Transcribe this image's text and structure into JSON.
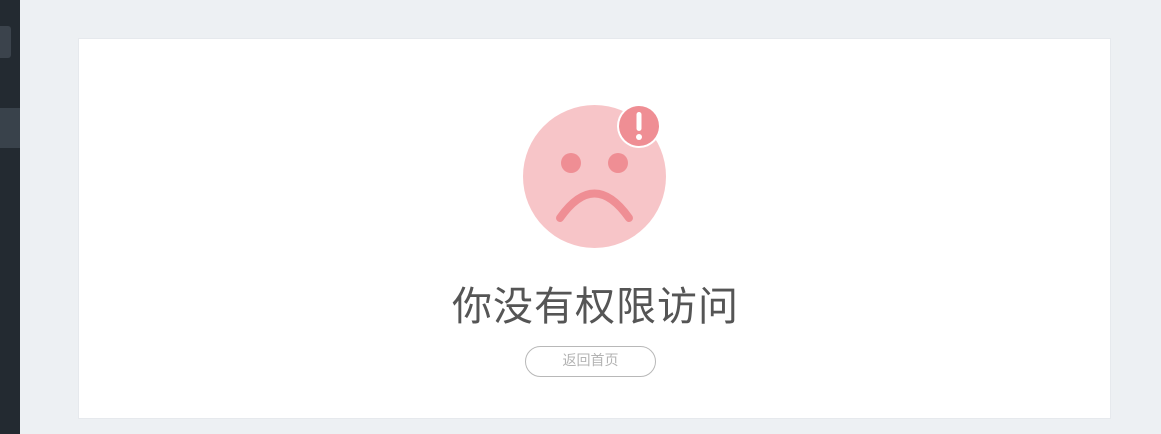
{
  "error": {
    "message": "你没有权限访问",
    "home_button_label": "返回首页",
    "icon": "sad-face-with-exclamation-icon"
  },
  "colors": {
    "face": "#f7c5c8",
    "face_features": "#ef8e94",
    "badge": "#ef8e94",
    "page_background": "#edf0f3",
    "sidebar": "#232a31"
  }
}
